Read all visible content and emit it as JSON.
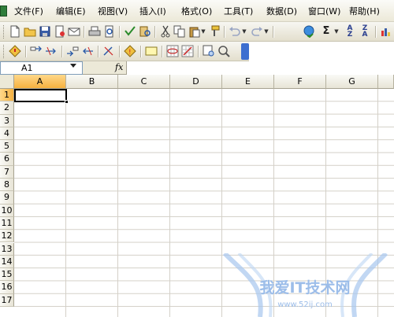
{
  "menu": {
    "items": [
      "文件(F)",
      "编辑(E)",
      "视图(V)",
      "插入(I)",
      "格式(O)",
      "工具(T)",
      "数据(D)",
      "窗口(W)",
      "帮助(H)"
    ]
  },
  "formula_bar": {
    "name_box": "A1",
    "fx_label": "fx",
    "formula": ""
  },
  "sheet": {
    "columns": [
      "A",
      "B",
      "C",
      "D",
      "E",
      "F",
      "G"
    ],
    "rows": [
      "1",
      "2",
      "3",
      "4",
      "5",
      "6",
      "7",
      "8",
      "9",
      "10",
      "11",
      "12",
      "13",
      "14",
      "15",
      "16",
      "17"
    ],
    "active_cell": "A1"
  },
  "watermark": {
    "title": "我爱IT技术网",
    "url": "www.52ij.com"
  },
  "colors": {
    "active_header": "#f6b13f",
    "grid_line": "#d4d0c8",
    "toolbar_bg": "#ece9d8"
  }
}
